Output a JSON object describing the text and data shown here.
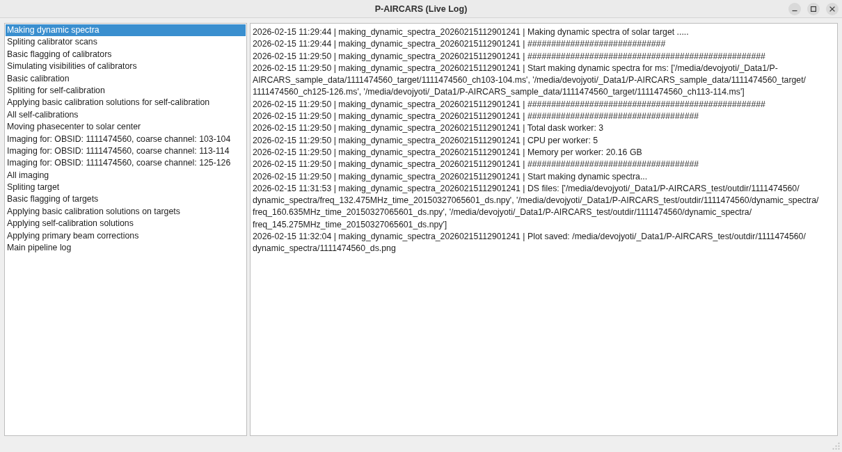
{
  "window": {
    "title": "P-AIRCARS (Live Log)"
  },
  "steps": [
    {
      "label": "Making dynamic spectra",
      "selected": true
    },
    {
      "label": "Spliting calibrator scans",
      "selected": false
    },
    {
      "label": "Basic flagging of calibrators",
      "selected": false
    },
    {
      "label": "Simulating visibilities of calibrators",
      "selected": false
    },
    {
      "label": "Basic calibration",
      "selected": false
    },
    {
      "label": "Spliting for self-calibration",
      "selected": false
    },
    {
      "label": "Applying basic calibration solutions for self-calibration",
      "selected": false
    },
    {
      "label": "All self-calibrations",
      "selected": false
    },
    {
      "label": "Moving phasecenter to solar center",
      "selected": false
    },
    {
      "label": "Imaging for: OBSID: 1111474560, coarse channel: 103-104",
      "selected": false
    },
    {
      "label": "Imaging for: OBSID: 1111474560, coarse channel: 113-114",
      "selected": false
    },
    {
      "label": "Imaging for: OBSID: 1111474560, coarse channel: 125-126",
      "selected": false
    },
    {
      "label": "All imaging",
      "selected": false
    },
    {
      "label": "Spliting target",
      "selected": false
    },
    {
      "label": "Basic flagging of targets",
      "selected": false
    },
    {
      "label": "Applying basic calibration solutions on targets",
      "selected": false
    },
    {
      "label": "Applying self-calibration solutions",
      "selected": false
    },
    {
      "label": "Applying primary beam corrections",
      "selected": false
    },
    {
      "label": "Main pipeline log",
      "selected": false
    }
  ],
  "log": {
    "lines": [
      "2026-02-15 11:29:44 | making_dynamic_spectra_20260215112901241 | Making dynamic spectra of solar target .....",
      "2026-02-15 11:29:44 | making_dynamic_spectra_20260215112901241 | #############################",
      "2026-02-15 11:29:50 | making_dynamic_spectra_20260215112901241 | ##################################################",
      "2026-02-15 11:29:50 | making_dynamic_spectra_20260215112901241 | Start making dynamic spectra for ms: ['/media/devojyoti/_Data1/P-AIRCARS_sample_data/1111474560_target/1111474560_ch103-104.ms', '/media/devojyoti/_Data1/P-AIRCARS_sample_data/1111474560_target/1111474560_ch125-126.ms', '/media/devojyoti/_Data1/P-AIRCARS_sample_data/1111474560_target/1111474560_ch113-114.ms']",
      "2026-02-15 11:29:50 | making_dynamic_spectra_20260215112901241 | ##################################################",
      "2026-02-15 11:29:50 | making_dynamic_spectra_20260215112901241 | ####################################",
      "2026-02-15 11:29:50 | making_dynamic_spectra_20260215112901241 | Total dask worker: 3",
      "2026-02-15 11:29:50 | making_dynamic_spectra_20260215112901241 | CPU per worker: 5",
      "2026-02-15 11:29:50 | making_dynamic_spectra_20260215112901241 | Memory per worker: 20.16 GB",
      "2026-02-15 11:29:50 | making_dynamic_spectra_20260215112901241 | ####################################",
      "2026-02-15 11:29:50 | making_dynamic_spectra_20260215112901241 | Start making dynamic spectra...",
      "2026-02-15 11:31:53 | making_dynamic_spectra_20260215112901241 | DS files: ['/media/devojyoti/_Data1/P-AIRCARS_test/outdir/1111474560/dynamic_spectra/freq_132.475MHz_time_20150327065601_ds.npy', '/media/devojyoti/_Data1/P-AIRCARS_test/outdir/1111474560/dynamic_spectra/freq_160.635MHz_time_20150327065601_ds.npy', '/media/devojyoti/_Data1/P-AIRCARS_test/outdir/1111474560/dynamic_spectra/freq_145.275MHz_time_20150327065601_ds.npy']",
      "2026-02-15 11:32:04 | making_dynamic_spectra_20260215112901241 | Plot saved: /media/devojyoti/_Data1/P-AIRCARS_test/outdir/1111474560/dynamic_spectra/1111474560_ds.png"
    ]
  }
}
